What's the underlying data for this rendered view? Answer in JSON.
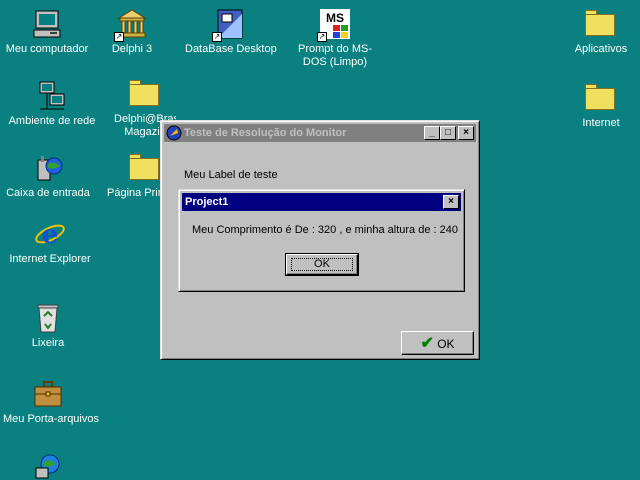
{
  "desktop": {
    "icons": [
      {
        "label": "Meu computador"
      },
      {
        "label": "Delphi 3"
      },
      {
        "label": "DataBase Desktop"
      },
      {
        "label": "Prompt do MS-DOS (Limpo)",
        "glyph_text": "MS"
      },
      {
        "label": "Aplicativos"
      },
      {
        "label": "Ambiente de rede"
      },
      {
        "label": "Delphi@Brasil Magazin"
      },
      {
        "label": "Internet"
      },
      {
        "label": "Caixa de entrada"
      },
      {
        "label": "Página Prin"
      },
      {
        "label": "Internet Explorer"
      },
      {
        "label": "Lixeira"
      },
      {
        "label": "Meu Porta-arquivos"
      }
    ]
  },
  "main_window": {
    "title": "Teste de Resolução do Monitor",
    "label": "Meu Label de teste",
    "ok_button": "OK",
    "minimize": "_",
    "maximize": "□",
    "close": "×"
  },
  "message_box": {
    "title": "Project1",
    "message": "Meu Comprimento é De : 320 , e minha altura de : 240",
    "ok_button": "OK",
    "close": "×"
  },
  "colors": {
    "desktop": "#0a8080",
    "active_title": "#000080",
    "inactive_title": "#808080"
  }
}
